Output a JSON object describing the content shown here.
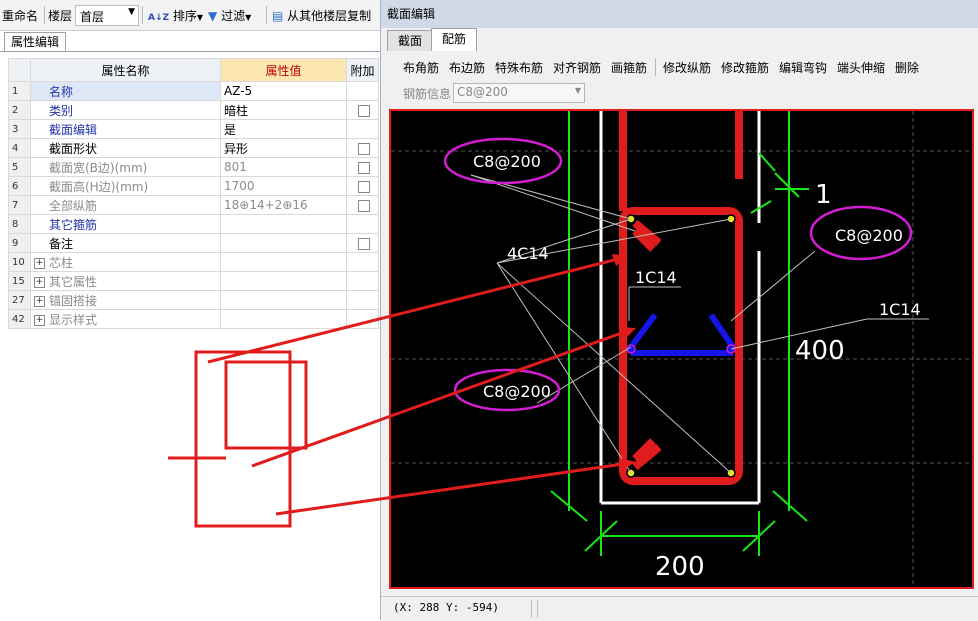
{
  "left_toolbar": {
    "rename": "重命名",
    "floor_label": "楼层",
    "floor_value": "首层",
    "sort": "排序",
    "filter": "过滤",
    "copy_from_floor": "从其他楼层复制"
  },
  "property_panel": {
    "tab": "属性编辑",
    "headers": {
      "name": "属性名称",
      "value": "属性值",
      "extra": "附加"
    },
    "rows": [
      {
        "num": "1",
        "name": "名称",
        "value": "AZ-5"
      },
      {
        "num": "2",
        "name": "类别",
        "value": "暗柱"
      },
      {
        "num": "3",
        "name": "截面编辑",
        "value": "是"
      },
      {
        "num": "4",
        "name": "截面形状",
        "value": "异形"
      },
      {
        "num": "5",
        "name": "截面宽(B边)(mm)",
        "value": "801"
      },
      {
        "num": "6",
        "name": "截面高(H边)(mm)",
        "value": "1700"
      },
      {
        "num": "7",
        "name": "全部纵筋",
        "value": "18⊕14+2⊕16"
      },
      {
        "num": "8",
        "name": "其它箍筋",
        "value": ""
      },
      {
        "num": "9",
        "name": "备注",
        "value": ""
      },
      {
        "num": "10",
        "name": "芯柱",
        "value": ""
      },
      {
        "num": "15",
        "name": "其它属性",
        "value": ""
      },
      {
        "num": "27",
        "name": "锚固搭接",
        "value": ""
      },
      {
        "num": "42",
        "name": "显示样式",
        "value": ""
      }
    ]
  },
  "dialog": {
    "title": "截面编辑",
    "tabs": [
      "截面",
      "配筋"
    ],
    "toolbar": [
      "布角筋",
      "布边筋",
      "特殊布筋",
      "对齐钢筋",
      "画箍筋",
      "修改纵筋",
      "修改箍筋",
      "编辑弯钩",
      "端头伸缩",
      "删除"
    ],
    "rebar_info_label": "钢筋信息",
    "rebar_info_value": "C8@200",
    "status_coords": "(X: 288 Y: -594)"
  },
  "drawing": {
    "labels": {
      "stirrup_top_left": "C8@200",
      "stirrup_right": "C8@200",
      "stirrup_bottom_left": "C8@200",
      "corner_bars": "4C14",
      "side_bar_left": "1C14",
      "side_bar_right": "1C14",
      "dim_width": "200",
      "dim_height": "400",
      "dim_small": "1"
    }
  },
  "colors": {
    "canvas_bg": "#000000",
    "rebar_red": "#e01c1c",
    "tie_blue": "#1515e8",
    "dim_green": "#19e619",
    "ellipse_magenta": "#d21ed2",
    "bar_yellow": "#e6e619",
    "selected_row": "#2f62c2"
  }
}
